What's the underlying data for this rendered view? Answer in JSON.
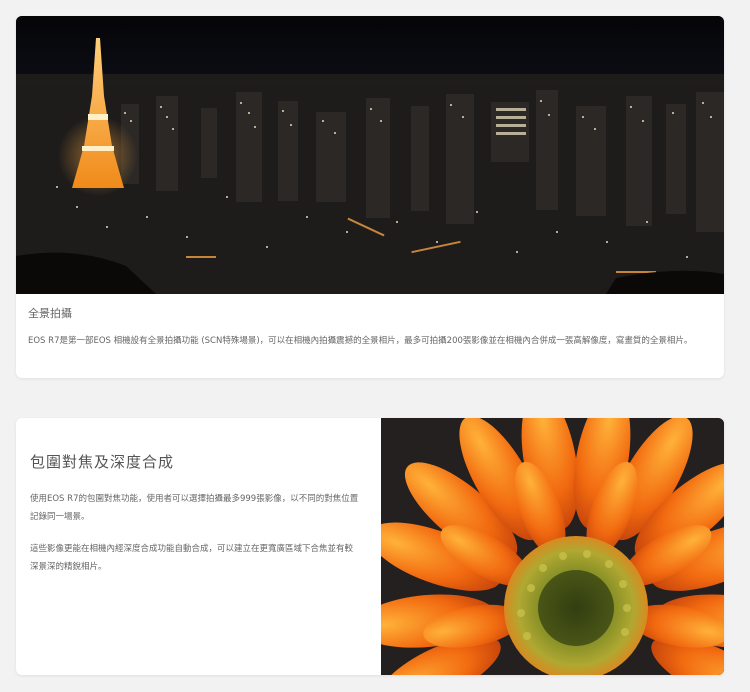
{
  "card_panorama": {
    "title": "全景拍攝",
    "body": "EOS R7是第一部EOS 相機設有全景拍攝功能 (SCN特殊場景)，可以在相機內拍攝震撼的全景相片，最多可拍攝200張影像並在相機內合併成一張高解像度，寫畫質的全景相片。"
  },
  "card_focus": {
    "title": "包圍對焦及深度合成",
    "paragraph1": "使用EOS R7的包圍對焦功能，使用者可以選擇拍攝最多999張影像，以不同的對焦位置記錄同一場景。",
    "paragraph2": "這些影像更能在相機內經深度合成功能自動合成，可以建立在更寬廣區域下合焦並有較深景深的精銳相片。"
  }
}
